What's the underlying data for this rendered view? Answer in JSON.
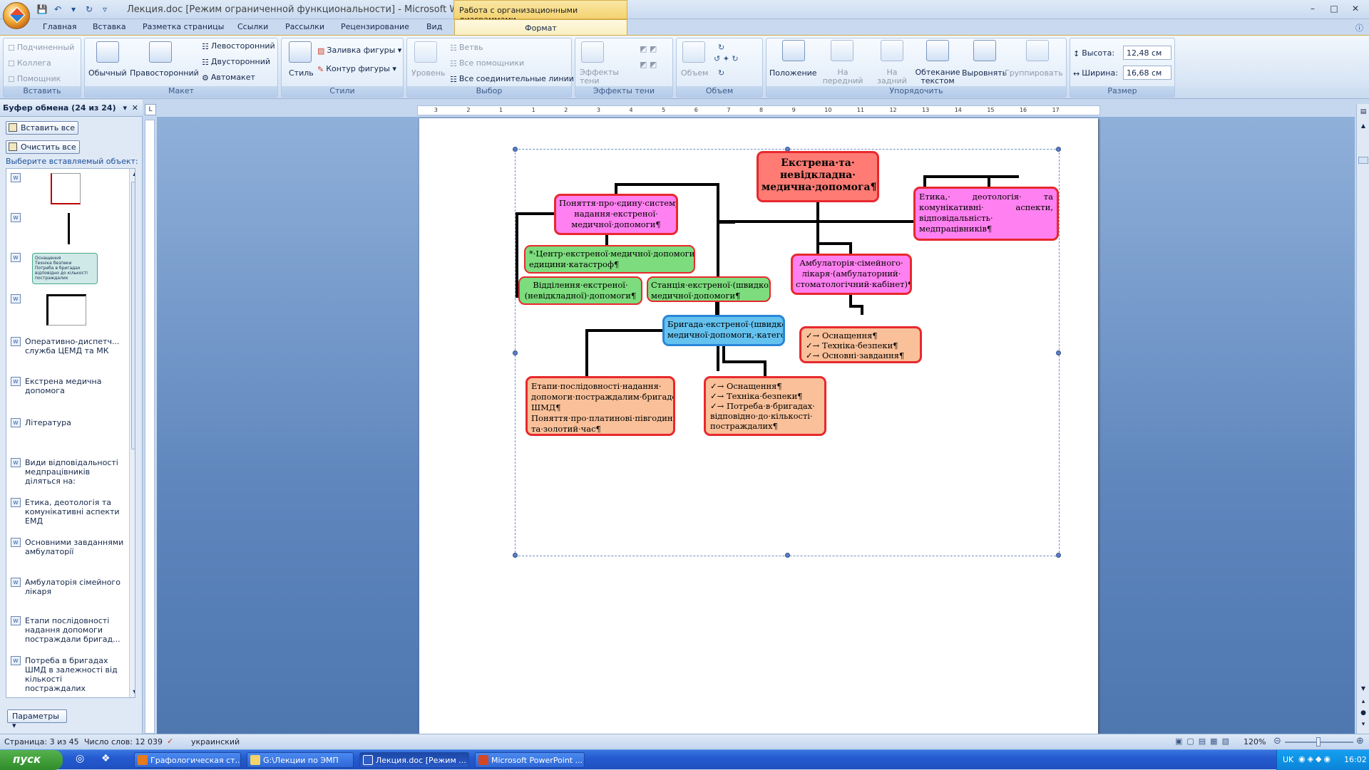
{
  "window": {
    "title": "Лекция.doc [Режим ограниченной функциональности] - Microsoft Wo...",
    "context_tab_title": "Работа с организационными диаграммами"
  },
  "tabs": [
    "Главная",
    "Вставка",
    "Разметка страницы",
    "Ссылки",
    "Рассылки",
    "Рецензирование",
    "Вид"
  ],
  "active_tab": "Формат",
  "ribbon": {
    "insert": {
      "title": "Вставить",
      "subordinate": "Подчиненный",
      "colleague": "Коллега",
      "assistant": "Помощник"
    },
    "layout": {
      "title": "Макет",
      "standard": "Обычный",
      "right_hanging": "Правосторонний",
      "left_hanging": "Левосторонний",
      "both": "Двусторонний",
      "auto": "Автомакет"
    },
    "styles": {
      "title": "Стили",
      "style": "Стиль",
      "shape_fill": "Заливка фигуры",
      "shape_outline": "Контур фигуры"
    },
    "select": {
      "title": "Выбор",
      "level": "Уровень",
      "branch": "Ветвь",
      "all_assistants": "Все помощники",
      "all_connectors": "Все соединительные линии"
    },
    "shadow": {
      "title": "Эффекты тени",
      "effects": "Эффекты тени"
    },
    "volume": {
      "title": "Объем",
      "volume": "Объем"
    },
    "arrange": {
      "title": "Упорядочить",
      "position": "Положение",
      "bring_front": "На передний план",
      "send_back": "На задний план",
      "text_wrap": "Обтекание текстом",
      "align": "Выровнять",
      "group": "Группировать"
    },
    "size": {
      "title": "Размер",
      "height_label": "Высота:",
      "height_value": "12,48 см",
      "width_label": "Ширина:",
      "width_value": "16,68 см"
    }
  },
  "pane": {
    "title": "Буфер обмена (24 из 24)",
    "paste_all": "Вставить все",
    "clear_all": "Очистить все",
    "hint": "Выберите вставляемый объект:",
    "params": "Параметры",
    "thumb_text": [
      "Оснащення",
      "Техніка безпеки",
      "Потреба в бригадах відповідно до кількості постраждалих"
    ],
    "items": [
      "Оперативно-диспетч... служба ЦЕМД та МК",
      "Екстрена медична допомога",
      "Література",
      "Види відповідальності медпрацівників діляться на:",
      "Етика, деотологія та комунікативні аспекти ЕМД",
      "Основними завданнями амбулаторії",
      "Амбулаторія сімейного лікаря",
      "Етапи послідовності надання допомоги постраждали бригад...",
      "Потреба в бригадах ШМД в залежності від кількості постраждалих"
    ]
  },
  "ruler_numbers": [
    "3",
    "2",
    "1",
    "1",
    "2",
    "3",
    "4",
    "5",
    "6",
    "7",
    "8",
    "9",
    "10",
    "11",
    "12",
    "13",
    "14",
    "15",
    "16",
    "17"
  ],
  "chart": {
    "root": "Екстрена·та· невідкладна· медична·допомога¶",
    "concept": "Поняття·про·єдину·систему· надання·екстреної· медичної·допомоги¶",
    "ethics": "Етика,· деотологія· та комунікативні· аспекти, відповідальність· медпрацівників¶",
    "center": "*·Центр·екстреної·медичної·допомоги·та· едицини·катастроф¶",
    "dept": "Відділення·екстреної· (невідкладної)·допомоги¶",
    "station": "Станція·екстреної·(швидкої)· медичної·допомоги¶",
    "ambulatory": "Амбулаторія·сімейного· лікаря·(амбулаторний· стоматологічний·кабінет)¶",
    "amb_items": [
      "Оснащення¶",
      "Техніка·безпеки¶",
      "Основні·завдання¶"
    ],
    "brigade": "Бригада·екстреної·(швидкої)· медичної·допомоги,·категорії",
    "stages": "Етапи·послідовності·надання· допомоги·постраждалим·бригадою· ШМД¶ Поняття·про·платинові·півгодини· та·золотий·час¶",
    "brig_items": [
      "Оснащення¶",
      "Техніка·безпеки¶",
      "Потреба·в·бригадах· відповідно·до·кількості· постраждалих¶"
    ]
  },
  "status": {
    "page": "Страница: 3 из 45",
    "words": "Число слов: 12 039",
    "lang": "украинский",
    "zoom": "120%"
  },
  "taskbar": {
    "start": "пуск",
    "tasks": [
      "Графологическая ст...",
      "G:\\Лекции по ЭМП",
      "Лекция.doc [Режим ...",
      "Microsoft PowerPoint ..."
    ],
    "lang": "UK",
    "clock": "16:02"
  },
  "colors": {
    "pink": "#ff80f0",
    "red_fill": "#ff7b74",
    "green": "#7ddc7d",
    "blue": "#64c2ef",
    "peach": "#f9c099",
    "border_red": "#e8282d"
  }
}
